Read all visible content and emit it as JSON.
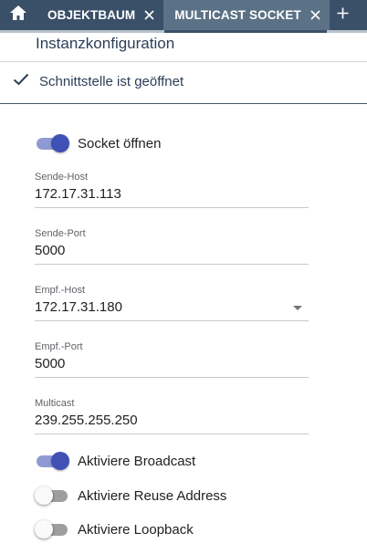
{
  "tabs": {
    "items": [
      {
        "label": "OBJEKTBAUM"
      },
      {
        "label": "MULTICAST SOCKET"
      }
    ]
  },
  "icons": {
    "home": "home-icon",
    "close": "close-icon",
    "add": "plus-icon",
    "check": "checkmark-icon"
  },
  "page": {
    "title": "Instanzkonfiguration",
    "status": "Schnittstelle ist geöffnet"
  },
  "socket_toggle": {
    "label": "Socket öffnen",
    "checked": true
  },
  "fields": {
    "send_host": {
      "label": "Sende-Host",
      "value": "172.17.31.113"
    },
    "send_port": {
      "label": "Sende-Port",
      "value": "5000"
    },
    "recv_host": {
      "label": "Empf.-Host",
      "value": "172.17.31.180"
    },
    "recv_port": {
      "label": "Empf.-Port",
      "value": "5000"
    },
    "multicast": {
      "label": "Multicast",
      "value": "239.255.255.250"
    }
  },
  "options": {
    "broadcast": {
      "label": "Aktiviere Broadcast",
      "checked": true
    },
    "reuse": {
      "label": "Aktiviere Reuse Address",
      "checked": false
    },
    "loopback": {
      "label": "Aktiviere Loopback",
      "checked": false
    }
  },
  "colors": {
    "tabbar": "#3a5068",
    "tab_active": "#5b7186",
    "toggle_on": "#3f51b5"
  }
}
